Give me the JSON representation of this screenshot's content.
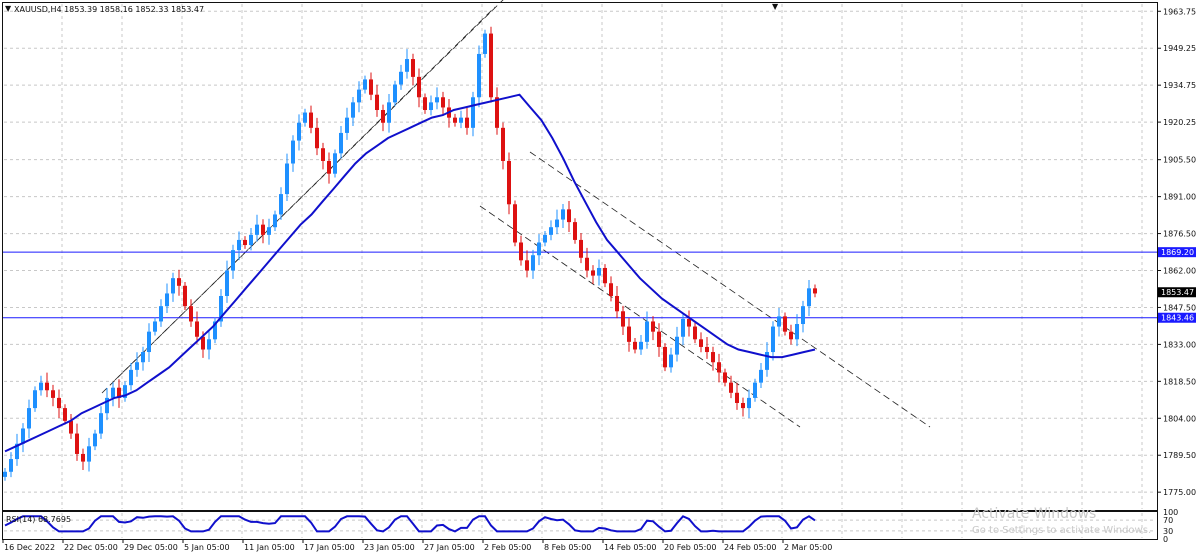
{
  "symbol_header": "XAUUSD,H4  1853.39 1858.16 1852.33 1853.47",
  "rsi_header": "RSI(14) 68.7695",
  "watermark": {
    "title": "Activate Windows",
    "subtitle": "Go to Settings to activate Windows."
  },
  "colors": {
    "bull": "#1e90ff",
    "bear": "#dd1111",
    "ma": "#1010cc",
    "hline": "#1a1aff",
    "rsi": "#1010cc",
    "grid": "#c8c8c8"
  },
  "price_scale": {
    "min": 1768,
    "max": 1967,
    "ticks": [
      "1963.75",
      "1949.25",
      "1934.75",
      "1920.25",
      "1905.50",
      "1891.00",
      "1876.50",
      "1862.00",
      "1847.50",
      "1833.00",
      "1818.50",
      "1804.00",
      "1789.50",
      "1775.00"
    ]
  },
  "rsi_scale": {
    "ticks": [
      "100",
      "70",
      "30",
      "0"
    ]
  },
  "time_labels": [
    "16 Dec 2022",
    "22 Dec 05:00",
    "29 Dec 05:00",
    "5 Jan 05:00",
    "11 Jan 05:00",
    "17 Jan 05:00",
    "23 Jan 05:00",
    "27 Jan 05:00",
    "2 Feb 05:00",
    "8 Feb 05:00",
    "14 Feb 05:00",
    "20 Feb 05:00",
    "24 Feb 05:00",
    "2 Mar 05:00"
  ],
  "price_tags": [
    {
      "value": "1869.20",
      "price": 1869.2,
      "kind": "line"
    },
    {
      "value": "1853.47",
      "price": 1853.47,
      "kind": "current"
    },
    {
      "value": "1843.46",
      "price": 1843.46,
      "kind": "line"
    }
  ],
  "chart_data": {
    "type": "candlestick",
    "symbol": "XAUUSD",
    "timeframe": "H4",
    "last_ohlc": {
      "open": 1853.39,
      "high": 1858.16,
      "low": 1852.33,
      "close": 1853.47
    },
    "price_closes": [
      1783,
      1788,
      1794,
      1800,
      1808,
      1815,
      1818,
      1815,
      1812,
      1808,
      1803,
      1798,
      1790,
      1787,
      1793,
      1798,
      1806,
      1812,
      1816,
      1812,
      1817,
      1823,
      1826,
      1830,
      1838,
      1842,
      1848,
      1853,
      1859,
      1856,
      1848,
      1842,
      1836,
      1831,
      1835,
      1842,
      1852,
      1862,
      1870,
      1874,
      1872,
      1876,
      1880,
      1876,
      1879,
      1884,
      1892,
      1904,
      1913,
      1920,
      1924,
      1918,
      1910,
      1905,
      1900,
      1908,
      1916,
      1922,
      1928,
      1933,
      1937,
      1931,
      1925,
      1920,
      1928,
      1935,
      1940,
      1945,
      1938,
      1930,
      1925,
      1928,
      1930,
      1926,
      1922,
      1920,
      1922,
      1918,
      1930,
      1947,
      1955,
      1930,
      1918,
      1905,
      1888,
      1873,
      1866,
      1862,
      1868,
      1873,
      1876,
      1879,
      1882,
      1886,
      1881,
      1874,
      1867,
      1862,
      1860,
      1863,
      1857,
      1852,
      1846,
      1840,
      1834,
      1831,
      1834,
      1842,
      1838,
      1832,
      1824,
      1829,
      1836,
      1843,
      1840,
      1835,
      1832,
      1830,
      1826,
      1822,
      1818,
      1814,
      1810,
      1808,
      1812,
      1818,
      1823,
      1830,
      1840,
      1844,
      1838,
      1835,
      1841,
      1848,
      1855,
      1853
    ],
    "moving_average": [
      1791,
      1793,
      1795,
      1797,
      1799,
      1801,
      1803,
      1806,
      1808,
      1810,
      1812,
      1813,
      1815,
      1818,
      1821,
      1824,
      1828,
      1832,
      1836,
      1840,
      1845,
      1850,
      1855,
      1860,
      1865,
      1870,
      1875,
      1880,
      1884,
      1889,
      1894,
      1899,
      1904,
      1908,
      1911,
      1914,
      1916,
      1918,
      1920,
      1922,
      1923,
      1925,
      1926,
      1927,
      1928,
      1929,
      1930,
      1931,
      1926,
      1921,
      1914,
      1906,
      1897,
      1889,
      1881,
      1874,
      1869,
      1864,
      1859,
      1855,
      1851,
      1848,
      1845,
      1842,
      1839,
      1836,
      1833,
      1831,
      1830,
      1829,
      1828,
      1828,
      1829,
      1830,
      1831
    ],
    "horizontal_lines": [
      1869.2,
      1843.46
    ],
    "rsi": {
      "period": 14,
      "last": 68.7695,
      "levels": [
        70,
        30
      ],
      "range": [
        0,
        100
      ]
    }
  }
}
